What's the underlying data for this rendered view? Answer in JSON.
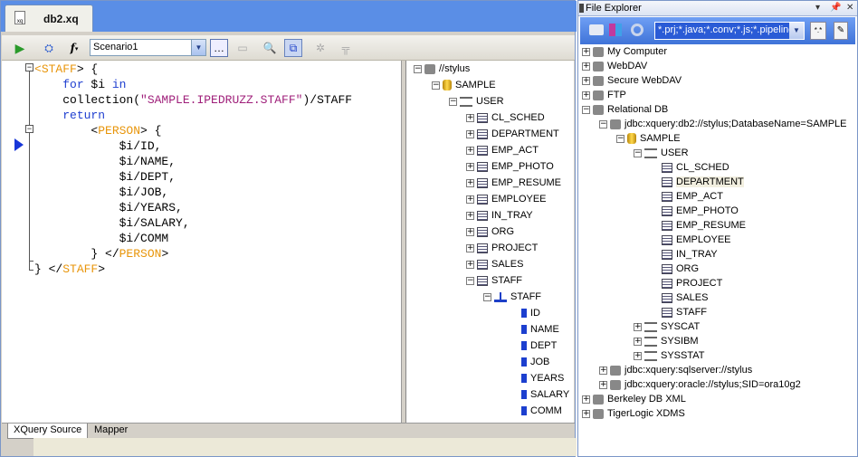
{
  "document_tab": {
    "label": "db2.xq"
  },
  "toolbar": {
    "scenario_value": "Scenario1"
  },
  "code_lines": [
    {
      "parts": [
        [
          "tag",
          "<"
        ],
        [
          "tag",
          "STAFF"
        ],
        [
          "txt",
          "> {"
        ]
      ]
    },
    {
      "parts": [
        [
          "txt",
          "    "
        ],
        [
          "kw",
          "for"
        ],
        [
          "txt",
          " $i "
        ],
        [
          "kw",
          "in"
        ]
      ]
    },
    {
      "parts": [
        [
          "txt",
          "    collection("
        ],
        [
          "str",
          "\"SAMPLE.IPEDRUZZ.STAFF\""
        ],
        [
          "txt",
          ")/STAFF"
        ]
      ]
    },
    {
      "parts": [
        [
          "txt",
          "    "
        ],
        [
          "kw",
          "return"
        ]
      ]
    },
    {
      "parts": [
        [
          "txt",
          "        <"
        ],
        [
          "tag",
          "PERSON"
        ],
        [
          "txt",
          "> {"
        ]
      ]
    },
    {
      "parts": [
        [
          "txt",
          "            $i/ID,"
        ]
      ]
    },
    {
      "parts": [
        [
          "txt",
          "            $i/NAME,"
        ]
      ]
    },
    {
      "parts": [
        [
          "txt",
          "            $i/DEPT,"
        ]
      ]
    },
    {
      "parts": [
        [
          "txt",
          "            $i/JOB,"
        ]
      ]
    },
    {
      "parts": [
        [
          "txt",
          "            $i/YEARS,"
        ]
      ]
    },
    {
      "parts": [
        [
          "txt",
          "            $i/SALARY,"
        ]
      ]
    },
    {
      "parts": [
        [
          "txt",
          "            $i/COMM"
        ]
      ]
    },
    {
      "parts": [
        [
          "txt",
          "        } </"
        ],
        [
          "tag",
          "PERSON"
        ],
        [
          "txt",
          ">"
        ]
      ]
    },
    {
      "parts": [
        [
          "txt",
          "} </"
        ],
        [
          "tag",
          "STAFF"
        ],
        [
          "txt",
          ">"
        ]
      ]
    }
  ],
  "schema_tree": {
    "root": "//stylus",
    "db": "SAMPLE",
    "schema": "USER",
    "tables": [
      "CL_SCHED",
      "DEPARTMENT",
      "EMP_ACT",
      "EMP_PHOTO",
      "EMP_RESUME",
      "EMPLOYEE",
      "IN_TRAY",
      "ORG",
      "PROJECT",
      "SALES",
      "STAFF"
    ],
    "structure": "STAFF",
    "fields": [
      "ID",
      "NAME",
      "DEPT",
      "JOB",
      "YEARS",
      "SALARY",
      "COMM"
    ]
  },
  "bottom_tabs": [
    "XQuery Source",
    "Mapper"
  ],
  "file_explorer": {
    "title": "File Explorer",
    "filter_value": "*.prj;*.java;*.conv;*.js;*.pipeline",
    "items": [
      {
        "label": "My Computer",
        "level": 0,
        "exp": "+",
        "icon": "computer-icon"
      },
      {
        "label": "WebDAV",
        "level": 0,
        "exp": "+",
        "icon": "globe-icon"
      },
      {
        "label": "Secure WebDAV",
        "level": 0,
        "exp": "+",
        "icon": "secure-globe-icon"
      },
      {
        "label": "FTP",
        "level": 0,
        "exp": "+",
        "icon": "ftp-icon"
      },
      {
        "label": "Relational DB",
        "level": 0,
        "exp": "-",
        "icon": "database-server-icon"
      },
      {
        "label": "jdbc:xquery:db2://stylus;DatabaseName=SAMPLE",
        "level": 1,
        "exp": "-",
        "icon": "connection-icon"
      },
      {
        "label": "SAMPLE",
        "level": 2,
        "exp": "-",
        "icon": "database-icon"
      },
      {
        "label": "USER",
        "level": 3,
        "exp": "-",
        "icon": "schema-icon"
      },
      {
        "label": "CL_SCHED",
        "level": 4,
        "exp": "",
        "icon": "table-icon"
      },
      {
        "label": "DEPARTMENT",
        "level": 4,
        "exp": "",
        "icon": "table-icon",
        "selected": true
      },
      {
        "label": "EMP_ACT",
        "level": 4,
        "exp": "",
        "icon": "table-icon"
      },
      {
        "label": "EMP_PHOTO",
        "level": 4,
        "exp": "",
        "icon": "table-icon"
      },
      {
        "label": "EMP_RESUME",
        "level": 4,
        "exp": "",
        "icon": "table-icon"
      },
      {
        "label": "EMPLOYEE",
        "level": 4,
        "exp": "",
        "icon": "table-icon"
      },
      {
        "label": "IN_TRAY",
        "level": 4,
        "exp": "",
        "icon": "table-icon"
      },
      {
        "label": "ORG",
        "level": 4,
        "exp": "",
        "icon": "table-icon"
      },
      {
        "label": "PROJECT",
        "level": 4,
        "exp": "",
        "icon": "table-icon"
      },
      {
        "label": "SALES",
        "level": 4,
        "exp": "",
        "icon": "table-icon"
      },
      {
        "label": "STAFF",
        "level": 4,
        "exp": "",
        "icon": "table-icon"
      },
      {
        "label": "SYSCAT",
        "level": 3,
        "exp": "+",
        "icon": "schema-icon"
      },
      {
        "label": "SYSIBM",
        "level": 3,
        "exp": "+",
        "icon": "schema-icon"
      },
      {
        "label": "SYSSTAT",
        "level": 3,
        "exp": "+",
        "icon": "schema-icon"
      },
      {
        "label": "jdbc:xquery:sqlserver://stylus",
        "level": 1,
        "exp": "+",
        "icon": "connection-icon"
      },
      {
        "label": "jdbc:xquery:oracle://stylus;SID=ora10g2",
        "level": 1,
        "exp": "+",
        "icon": "connection-icon"
      },
      {
        "label": "Berkeley DB XML",
        "level": 0,
        "exp": "+",
        "icon": "berkeley-db-icon"
      },
      {
        "label": "TigerLogic XDMS",
        "level": 0,
        "exp": "+",
        "icon": "tigerlogic-icon"
      }
    ]
  }
}
